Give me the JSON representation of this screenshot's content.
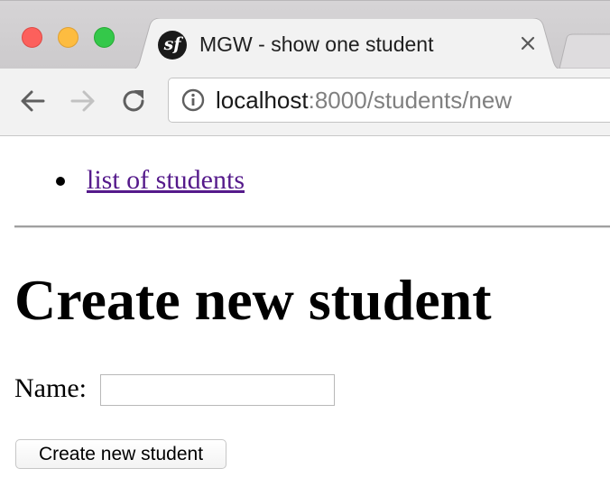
{
  "browser": {
    "tab": {
      "title": "MGW - show one student",
      "favicon_glyph": "sf",
      "favicon_name": "symfony-logo-icon"
    },
    "address_bar": {
      "host": "localhost",
      "rest": ":8000/students/new"
    },
    "colors": {
      "close": "#fc605c",
      "minimize": "#fdbc40",
      "zoom": "#34c84a"
    }
  },
  "page": {
    "nav": {
      "items": [
        {
          "label": "list of students"
        }
      ]
    },
    "title": "Create new student",
    "form": {
      "name_label": "Name:",
      "name_value": "",
      "submit_label": "Create new student"
    },
    "colors": {
      "visited_link": "#551a8b"
    }
  }
}
